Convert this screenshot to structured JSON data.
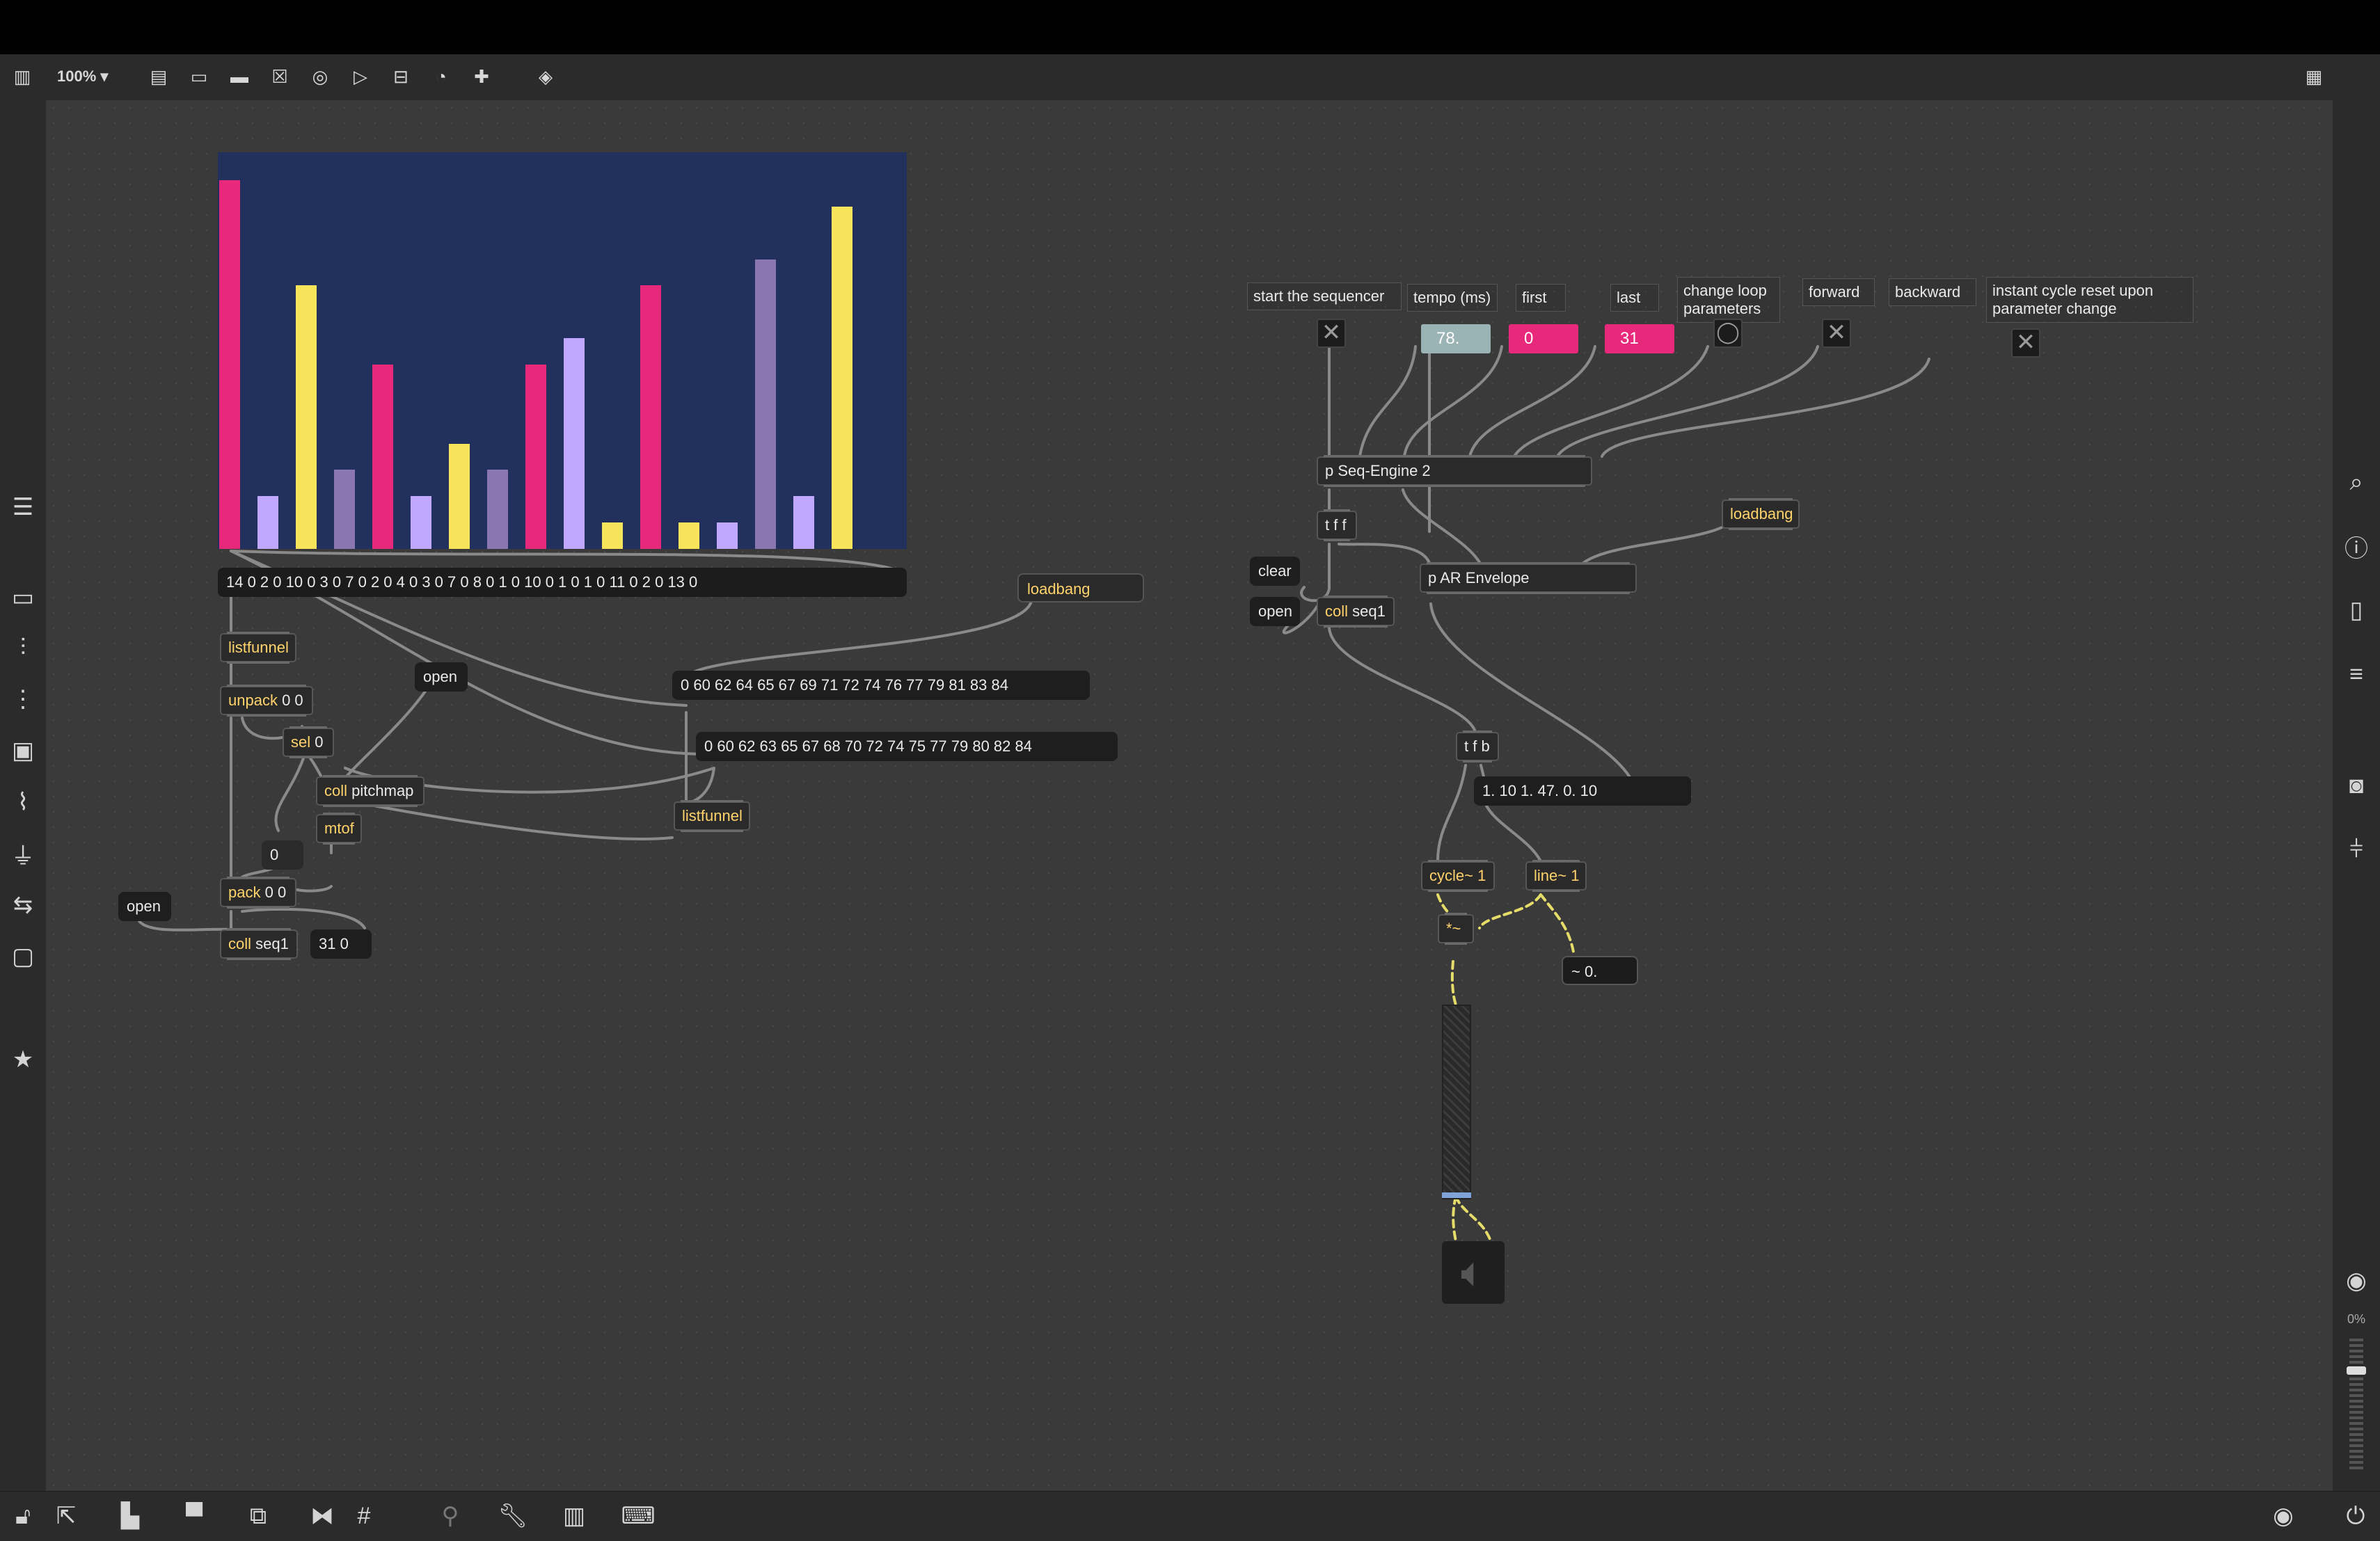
{
  "toolbar": {
    "zoom": "100%",
    "icons": [
      "sidebar-icon",
      "presentation-icon",
      "message-icon",
      "comment-icon",
      "toggle-icon",
      "button-icon",
      "play-icon",
      "slider-icon",
      "dial-icon",
      "plus-icon",
      "paint-bucket-icon"
    ],
    "grid_icon": "grid-icon"
  },
  "colors": {
    "canvas": "#3a3a3a",
    "accent_pink": "#e8287a",
    "accent_yellow": "#f7e45a",
    "accent_lavender": "#c0a8ff",
    "accent_purple": "#8a76b0",
    "multislider_bg": "#22305e"
  },
  "multislider": {
    "values": [
      14,
      2,
      10,
      3,
      7,
      2,
      4,
      3,
      7,
      8,
      1,
      10,
      1,
      1,
      11,
      2,
      13,
      0
    ],
    "colors": [
      "#e8287a",
      "#c0a8ff",
      "#f7e45a",
      "#8a76b0",
      "#e8287a",
      "#c0a8ff",
      "#f7e45a",
      "#8a76b0",
      "#e8287a",
      "#c0a8ff",
      "#f7e45a",
      "#e8287a",
      "#f7e45a",
      "#c0a8ff",
      "#8a76b0",
      "#c0a8ff",
      "#f7e45a",
      "#8a76b0"
    ],
    "max": 14
  },
  "patch": {
    "list_message": "14 0 2 0 10 0 3 0 7 0 2 0 4 0 3 0 7 0 8 0 1 0 10 0 1 0 1 0 11 0 2 0 13 0",
    "loadbang1": "loadbang",
    "scale1": "0 60 62 64 65 67 69 71 72 74 76 77 79 81 83 84",
    "scale2": "0 60 62 63 65 67 68 70 72 74 75 77 79 80 82 84",
    "listfunnel": "listfunnel",
    "listfunnel2": "listfunnel",
    "unpack": "unpack",
    "unpack_args": "0 0",
    "sel": "sel",
    "sel_args": "0",
    "open1": "open",
    "coll1": "coll",
    "coll1_args": "pitchmap",
    "mtof": "mtof",
    "zero": "0",
    "pack": "pack",
    "pack_args": "0 0",
    "open2": "open",
    "coll2": "coll",
    "coll2_args": "seq1",
    "msg_31": "31 0"
  },
  "engine": {
    "labels": [
      "start the sequencer",
      "tempo (ms)",
      "first",
      "last",
      "change loop parameters",
      "forward",
      "backward",
      "instant cycle reset upon parameter change"
    ],
    "tempo": "78.",
    "first": "0",
    "last": "31",
    "seq_engine": "p Seq-Engine 2",
    "tff": "t f f",
    "loadbang": "loadbang",
    "clear": "clear",
    "open": "open",
    "coll": "coll",
    "coll_args": "seq1",
    "ar_envelope": "p AR Envelope",
    "tfb": "t f b",
    "env_msg": "1. 10 1. 47. 0. 10",
    "cycle": "cycle~ 1",
    "line": "line~ 1",
    "times": "*~",
    "number_tilde": "~ 0."
  },
  "rightbar": {
    "volume": "0%"
  }
}
